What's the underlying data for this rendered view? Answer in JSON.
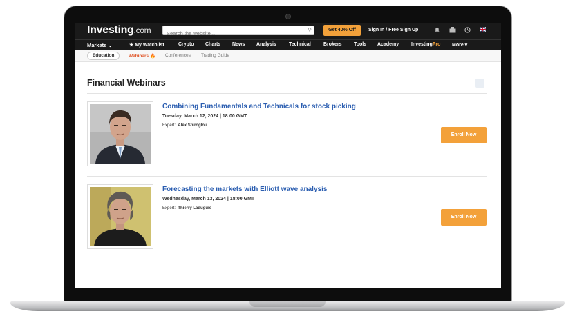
{
  "header": {
    "logo_main": "Investing",
    "logo_suffix": ".com",
    "search_placeholder": "Search the website...",
    "promo_label": "Get 40% Off",
    "signin_label": "Sign In / Free Sign Up"
  },
  "nav": {
    "items": [
      "Markets ⌄",
      "★ My Watchlist",
      "Crypto",
      "Charts",
      "News",
      "Analysis",
      "Technical",
      "Brokers",
      "Tools",
      "Academy",
      "InvestingPro",
      "More ▾"
    ],
    "pro_prefix": "Investing",
    "pro_suffix": "Pro"
  },
  "subnav": {
    "items": [
      "Education",
      "Webinars 🔥",
      "Conferences",
      "Trading Guide"
    ],
    "active": "Webinars"
  },
  "page": {
    "title": "Financial Webinars",
    "info_icon": "i"
  },
  "webinars": [
    {
      "title": "Combining Fundamentals and Technicals for stock picking",
      "date": "Tuesday, March 12, 2024 | 18:00 GMT",
      "expert_label": "Expert:",
      "expert_name": "Alex Spiroglou",
      "button": "Enroll Now"
    },
    {
      "title": "Forecasting the markets with Elliott wave analysis",
      "date": "Wednesday, March 13, 2024 | 18:00 GMT",
      "expert_label": "Expert:",
      "expert_name": "Thierry Laduguie",
      "button": "Enroll Now"
    }
  ],
  "colors": {
    "header_bg": "#1a1a1a",
    "accent_orange": "#f3a13a",
    "link_blue": "#2a5db0",
    "active_subnav": "#e0572a"
  },
  "icons": [
    "search-icon",
    "bell-icon",
    "briefcase-icon",
    "clock-icon",
    "uk-flag-icon",
    "info-icon"
  ]
}
